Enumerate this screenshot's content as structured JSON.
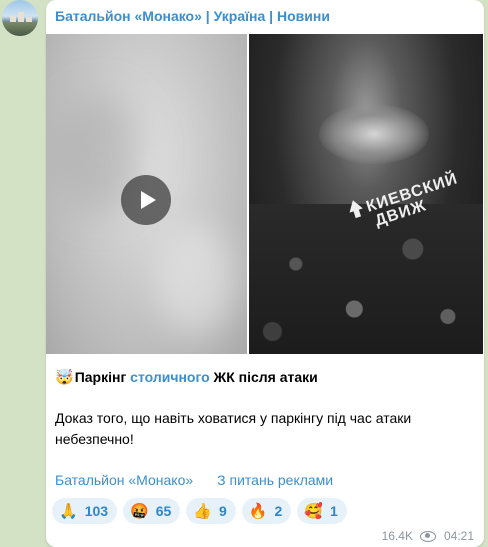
{
  "channel": {
    "title": "Батальйон «Монако» | Україна | Новини"
  },
  "media": {
    "watermark_line1": "КИЕВСКИЙ",
    "watermark_line2": "ДВИЖ"
  },
  "post": {
    "caption_emoji": "🤯",
    "caption_part1": "Паркінг ",
    "caption_link": "столичного",
    "caption_part2": " ЖК після атаки",
    "body": "Доказ того, що навіть ховатися у паркінгу під час атаки небезпечно!",
    "link1": "Батальйон «Монако»",
    "link2": "З питань реклами"
  },
  "reactions": [
    {
      "emoji": "🙏",
      "count": "103"
    },
    {
      "emoji": "🤬",
      "count": "65"
    },
    {
      "emoji": "👍",
      "count": "9"
    },
    {
      "emoji": "🔥",
      "count": "2"
    },
    {
      "emoji": "🥰",
      "count": "1"
    }
  ],
  "meta": {
    "views": "16.4K",
    "time": "04:21"
  },
  "colors": {
    "link": "#3a8fd0",
    "background": "#d3e1c5",
    "reaction_bg": "#e6f1fa"
  }
}
